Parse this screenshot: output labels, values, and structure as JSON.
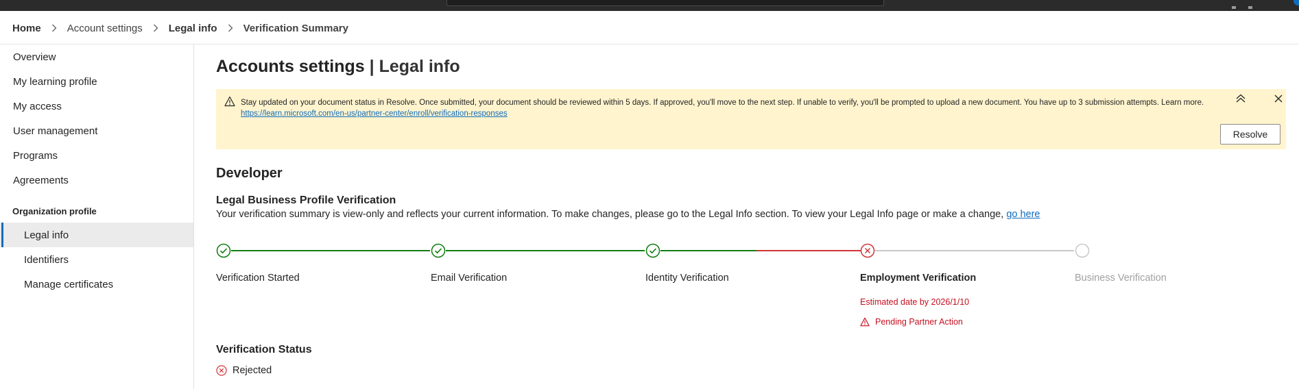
{
  "breadcrumb": {
    "items": [
      {
        "label": "Home"
      },
      {
        "label": "Account settings"
      },
      {
        "label": "Legal info"
      },
      {
        "label": "Verification Summary"
      }
    ]
  },
  "sidebar": {
    "items": [
      {
        "label": "Overview"
      },
      {
        "label": "My learning profile"
      },
      {
        "label": "My access"
      },
      {
        "label": "User management"
      },
      {
        "label": "Programs"
      },
      {
        "label": "Agreements"
      }
    ],
    "section_heading": "Organization profile",
    "sub_items": [
      {
        "label": "Legal info",
        "active": true
      },
      {
        "label": "Identifiers"
      },
      {
        "label": "Manage certificates"
      }
    ]
  },
  "page": {
    "title_main": "Accounts settings",
    "title_sep": " | ",
    "title_sub": "Legal info"
  },
  "banner": {
    "icon": "warning-icon",
    "text": "Stay updated on your document status in Resolve. Once submitted, your document should be reviewed within 5 days. If approved, you'll move to the next step. If unable to verify, you'll be prompted to upload a new document. You have up to 3 submission attempts. Learn more.",
    "link": "https://learn.microsoft.com/en-us/partner-center/enroll/verification-responses",
    "resolve_label": "Resolve",
    "background": "#fff4ce"
  },
  "section": {
    "title": "Developer"
  },
  "verification": {
    "title": "Legal Business Profile Verification",
    "description": "Your verification summary is view-only and reflects your current information. To make changes, please go to the Legal Info section. To view your Legal Info page or make a change, ",
    "link_text": "go here",
    "steps": [
      {
        "label": "Verification Started",
        "status": "complete"
      },
      {
        "label": "Email Verification",
        "status": "complete"
      },
      {
        "label": "Identity Verification",
        "status": "complete"
      },
      {
        "label": "Employment Verification",
        "status": "error",
        "estimated": "Estimated date by 2026/1/10",
        "action": "Pending Partner Action"
      },
      {
        "label": "Business Verification",
        "status": "pending"
      }
    ]
  },
  "status": {
    "title": "Verification Status",
    "value": "Rejected"
  },
  "colors": {
    "success": "#107c10",
    "error": "#c50f1f",
    "pending": "#c8c8c8",
    "accent": "#0f6cbd"
  }
}
